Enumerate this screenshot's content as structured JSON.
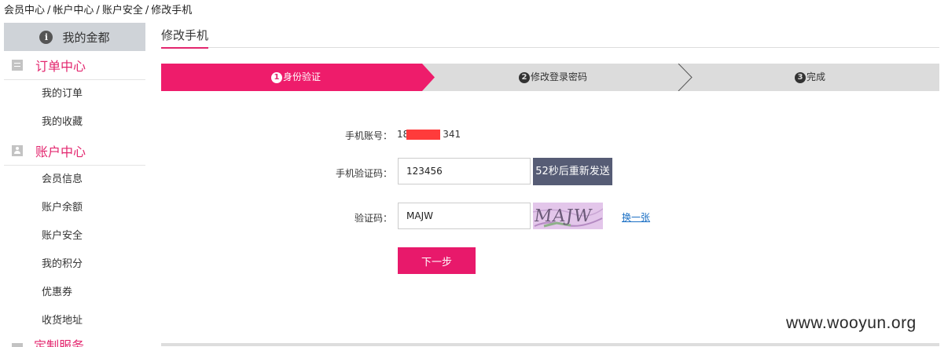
{
  "breadcrumb": [
    "会员中心",
    "帐户中心",
    "账户安全",
    "修改手机"
  ],
  "breadcrumb_sep": "/",
  "sidebar": {
    "head": "我的金都",
    "sections": [
      {
        "title": "订单中心",
        "icon": "list-icon",
        "items": [
          "我的订单",
          "我的收藏"
        ]
      },
      {
        "title": "账户中心",
        "icon": "user-icon",
        "items": [
          "会员信息",
          "账户余额",
          "账户安全",
          "我的积分",
          "优惠券",
          "收货地址"
        ]
      }
    ],
    "next_section": "定制服务"
  },
  "page": {
    "tab_title": "修改手机",
    "steps": [
      {
        "num": "1",
        "label": "身份验证",
        "active": true
      },
      {
        "num": "2",
        "label": "修改登录密码",
        "active": false
      },
      {
        "num": "3",
        "label": "完成",
        "active": false
      }
    ]
  },
  "form": {
    "phone_label": "手机账号：",
    "phone_prefix": "18",
    "phone_suffix": "341",
    "sms_label": "手机验证码：",
    "sms_value": "123456",
    "resend_label": "52秒后重新发送",
    "captcha_label": "验证码：",
    "captcha_value": "MAJW",
    "captcha_image_text": "MAJW",
    "refresh_label": "换一张",
    "next_label": "下一步"
  },
  "watermark": "www.wooyun.org",
  "colors": {
    "accent": "#e3266e",
    "button": "#e8196b",
    "resend": "#565c75",
    "link": "#1a6fc4"
  }
}
